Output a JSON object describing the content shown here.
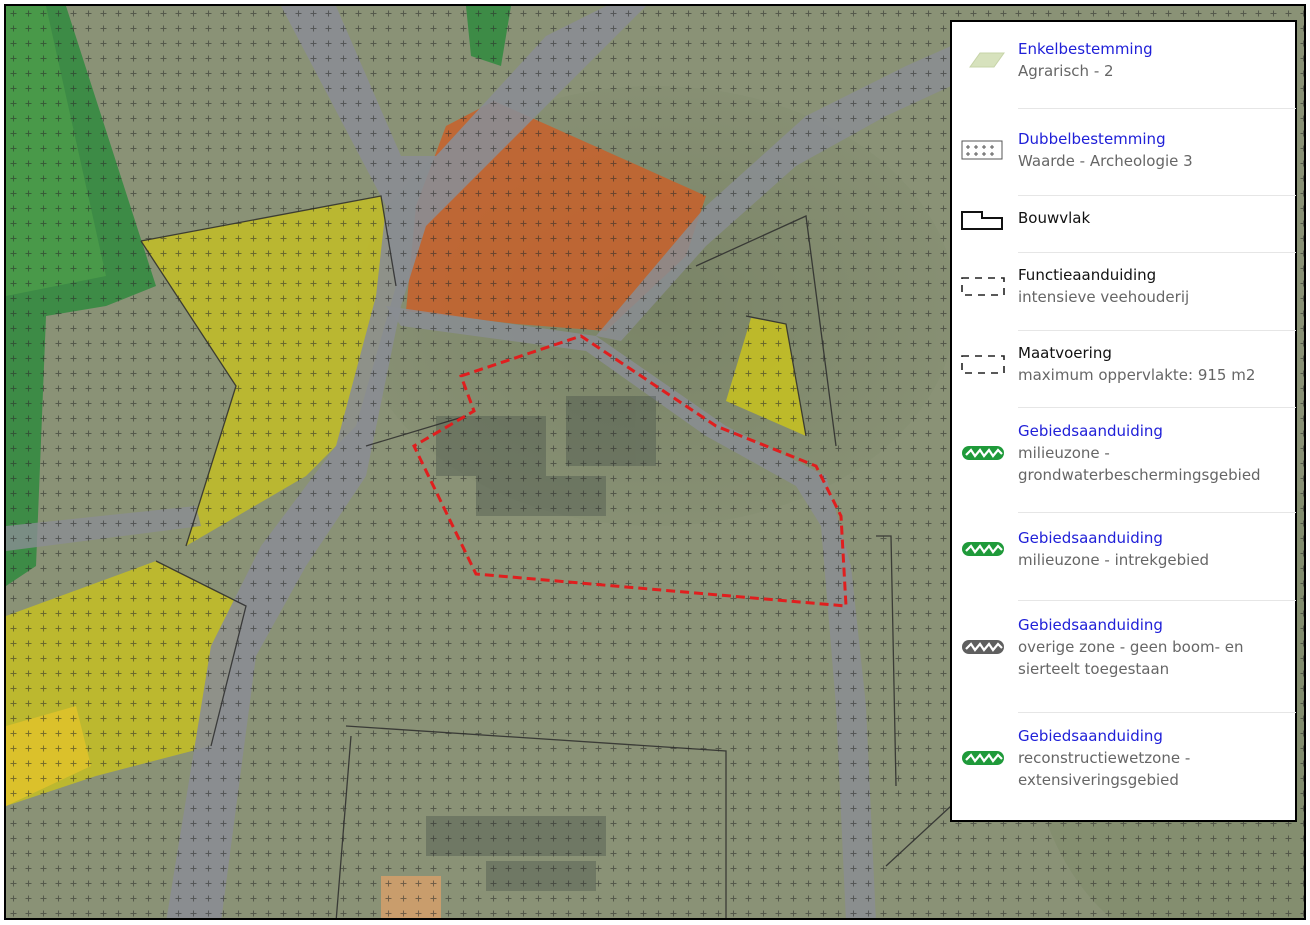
{
  "map": {
    "colors": {
      "orthophoto": "#8a9276",
      "road": "#8a8d93",
      "green_field": "#2f8a3e",
      "agricultural_yellow": "#c8c21e",
      "residential_orange": "#c8602a",
      "outline": "#2b2b2b",
      "selection": "#e01e1e"
    },
    "icons": [
      "crosshatch-pattern-icon",
      "selection-outline-icon"
    ]
  },
  "legend": {
    "items": [
      {
        "title": "Enkelbestemming",
        "desc": "Agrarisch - 2",
        "icon": "agrarisch-swatch-icon",
        "title_color": "#2020d8"
      },
      {
        "title": "Dubbelbestemming",
        "desc": "Waarde - Archeologie 3",
        "icon": "crosses-grid-icon",
        "title_color": "#2020d8"
      },
      {
        "title": "Bouwvlak",
        "desc": "",
        "icon": "bouwvlak-outline-icon",
        "title_color": "#111111"
      },
      {
        "title": "Functieaanduiding",
        "desc": "intensieve veehouderij",
        "icon": "dashed-rectangle-icon",
        "title_color": "#111111"
      },
      {
        "title": "Maatvoering",
        "desc": "maximum oppervlakte: 915 m2",
        "icon": "dashed-rectangle-icon",
        "title_color": "#111111"
      },
      {
        "title": "Gebiedsaanduiding",
        "desc": "milieuzone - grondwaterbeschermingsgebied",
        "icon": "green-zigzag-icon",
        "title_color": "#2020d8"
      },
      {
        "title": "Gebiedsaanduiding",
        "desc": "milieuzone - intrekgebied",
        "icon": "green-zigzag-icon",
        "title_color": "#2020d8"
      },
      {
        "title": "Gebiedsaanduiding",
        "desc": "overige zone - geen boom- en sierteelt toegestaan",
        "icon": "grey-zigzag-icon",
        "title_color": "#2020d8"
      },
      {
        "title": "Gebiedsaanduiding",
        "desc": "reconstructiewetzone - extensiveringsgebied",
        "icon": "green-zigzag-icon",
        "title_color": "#2020d8"
      }
    ]
  }
}
